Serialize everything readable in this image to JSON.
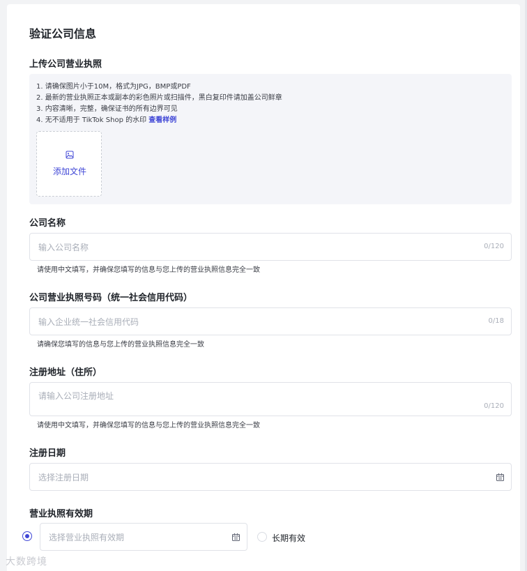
{
  "page": {
    "title": "验证公司信息"
  },
  "license_upload": {
    "label": "上传公司营业执照",
    "requirements": [
      "1. 请确保图片小于10M，格式为JPG，BMP或PDF",
      "2. 最新的营业执照正本或副本的彩色照片或扫描件，黑白复印件请加盖公司鲜章",
      "3. 内容清晰，完整，确保证书的所有边界可见",
      "4. 无不适用于 TikTok Shop 的水印"
    ],
    "sample_link": "查看样例",
    "add_file_label": "添加文件",
    "add_file_icon": "image-icon"
  },
  "company_name": {
    "label": "公司名称",
    "placeholder": "输入公司名称",
    "value": "",
    "counter": "0/120",
    "hint": "请使用中文填写，并确保您填写的信息与您上传的营业执照信息完全一致"
  },
  "credit_code": {
    "label": "公司营业执照号码（统一社会信用代码）",
    "placeholder": "输入企业统一社会信用代码",
    "value": "",
    "counter": "0/18",
    "hint": "请确保您填写的信息与您上传的营业执照信息完全一致"
  },
  "registered_address": {
    "label": "注册地址（住所）",
    "placeholder": "请输入公司注册地址",
    "value": "",
    "counter": "0/120",
    "hint": "请使用中文填写，并确保您填写的信息与您上传的营业执照信息完全一致"
  },
  "registration_date": {
    "label": "注册日期",
    "placeholder": "选择注册日期",
    "icon": "calendar-icon"
  },
  "license_validity": {
    "label": "营业执照有效期",
    "placeholder": "选择营业执照有效期",
    "icon": "calendar-icon",
    "long_term_label": "长期有效",
    "selected": "date"
  },
  "watermark": "大数跨境",
  "colors": {
    "accent": "#3f46d6",
    "border": "#e0e2e8",
    "placeholder": "#a9aeb8",
    "upload_bg": "#f4f5f9"
  }
}
